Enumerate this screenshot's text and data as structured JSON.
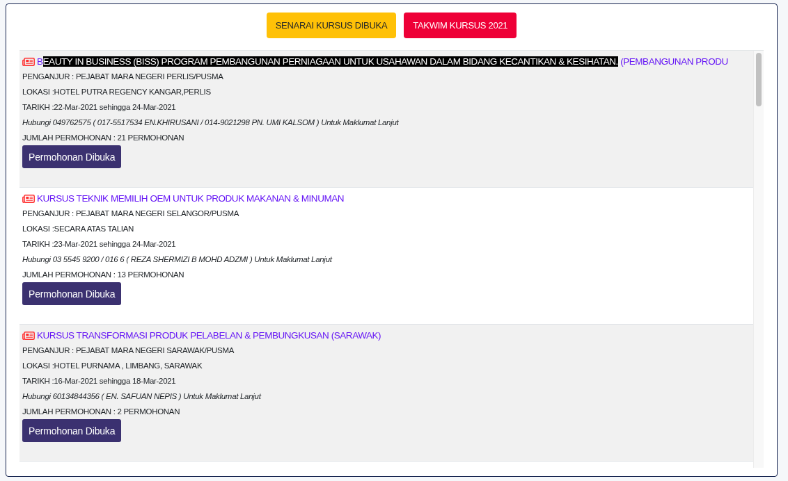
{
  "header_buttons": [
    {
      "label": "SENARAI KURSUS DIBUKA",
      "kind": "warning"
    },
    {
      "label": "TAKWIM KURSUS 2021",
      "kind": "danger"
    }
  ],
  "courses": [
    {
      "title": [
        {
          "text": "B",
          "highlighted": false
        },
        {
          "text": "EAUTY IN BUSINESS (BISS) PROGRAM PEMBANGUNAN PERNIAGAAN UNTUK USAHAWAN DALAM BIDANG KECANTIKAN & KESIHATAN.",
          "highlighted": true
        },
        {
          "text": " (PEMBANGUNAN PRODU",
          "highlighted": false
        }
      ],
      "organizer": "PENGANJUR : PEJABAT MARA NEGERI PERLIS/PUSMA",
      "location": "LOKASI :HOTEL PUTRA REGENCY KANGAR,PERLIS",
      "date": "TARIKH :22-Mar-2021 sehingga 24-Mar-2021",
      "contact": "Hubungi 049762575 ( 017-5517534 EN.KHIRUSANI / 014-9021298 PN. UMI KALSOM ) Untuk Maklumat Lanjut",
      "applications": "JUMLAH PERMOHONAN : 21 PERMOHONAN",
      "button": "Permohonan Dibuka"
    },
    {
      "title": [
        {
          "text": "KURSUS TEKNIK MEMILIH OEM UNTUK PRODUK MAKANAN & MINUMAN",
          "highlighted": false
        }
      ],
      "organizer": "PENGANJUR : PEJABAT MARA NEGERI SELANGOR/PUSMA",
      "location": "LOKASI :SECARA ATAS TALIAN",
      "date": "TARIKH :23-Mar-2021 sehingga 24-Mar-2021",
      "contact": "Hubungi 03 5545 9200 / 016 6 ( REZA SHERMIZI B MOHD ADZMI ) Untuk Maklumat Lanjut",
      "applications": "JUMLAH PERMOHONAN : 13 PERMOHONAN",
      "button": "Permohonan Dibuka"
    },
    {
      "title": [
        {
          "text": "KURSUS TRANSFORMASI PRODUK PELABELAN & PEMBUNGKUSAN (SARAWAK)",
          "highlighted": false
        }
      ],
      "organizer": "PENGANJUR : PEJABAT MARA NEGERI SARAWAK/PUSMA",
      "location": "LOKASI :HOTEL PURNAMA , LIMBANG, SARAWAK",
      "date": "TARIKH :16-Mar-2021 sehingga 18-Mar-2021",
      "contact": "Hubungi 60134844356 ( EN. SAFUAN NEPIS ) Untuk Maklumat Lanjut",
      "applications": "JUMLAH PERMOHONAN : 2 PERMOHONAN",
      "button": "Permohonan Dibuka"
    }
  ]
}
